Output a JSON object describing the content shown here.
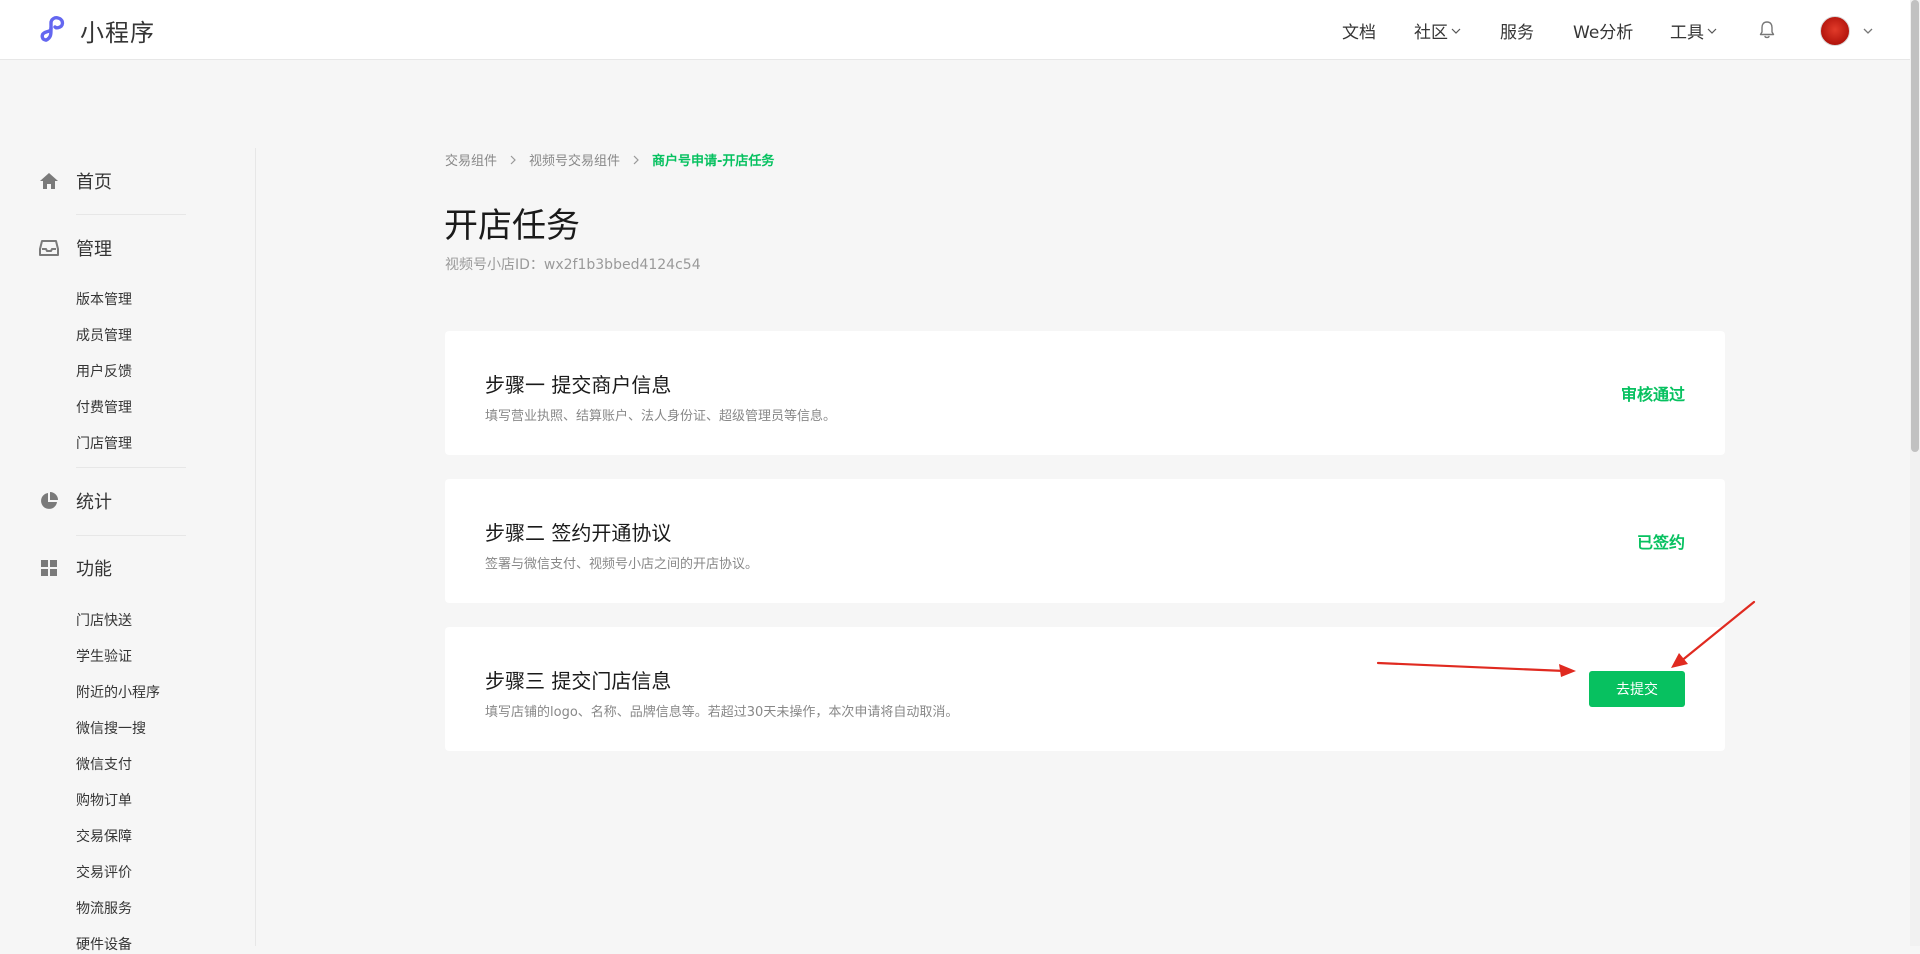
{
  "header": {
    "brand": "小程序",
    "nav": {
      "docs": "文档",
      "community": "社区",
      "service": "服务",
      "analytics": "We分析",
      "tools": "工具"
    }
  },
  "sidebar": {
    "home": "首页",
    "manage": {
      "label": "管理",
      "items": [
        "版本管理",
        "成员管理",
        "用户反馈",
        "付费管理",
        "门店管理"
      ]
    },
    "stats": "统计",
    "features": {
      "label": "功能",
      "items": [
        "门店快送",
        "学生验证",
        "附近的小程序",
        "微信搜一搜",
        "微信支付",
        "购物订单",
        "交易保障",
        "交易评价",
        "物流服务",
        "硬件设备"
      ]
    }
  },
  "breadcrumb": [
    "交易组件",
    "视频号交易组件",
    "商户号申请-开店任务"
  ],
  "page": {
    "title": "开店任务",
    "store_id": "视频号小店ID：wx2f1b3bbed4124c54"
  },
  "steps": [
    {
      "title": "步骤一 提交商户信息",
      "desc": "填写营业执照、结算账户、法人身份证、超级管理员等信息。",
      "status": "审核通过"
    },
    {
      "title": "步骤二 签约开通协议",
      "desc": "签署与微信支付、视频号小店之间的开店协议。",
      "status": "已签约"
    },
    {
      "title": "步骤三 提交门店信息",
      "desc": "填写店铺的logo、名称、品牌信息等。若超过30天未操作，本次申请将自动取消。",
      "action": "去提交"
    }
  ],
  "colors": {
    "accent": "#07c160",
    "annotation_arrow": "#e02a20"
  }
}
